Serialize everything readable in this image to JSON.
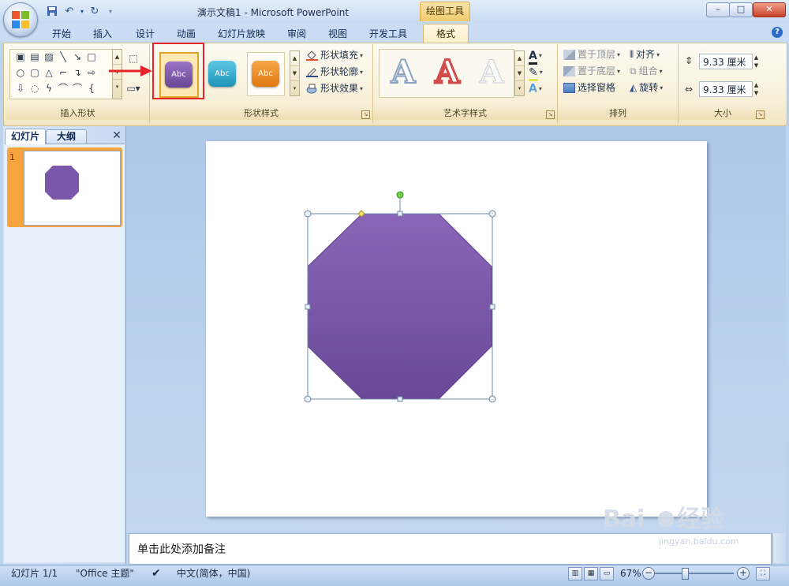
{
  "title_bar": {
    "title": "演示文稿1 - Microsoft PowerPoint",
    "contextual_tab": "绘图工具",
    "minimize": "–",
    "maximize": "□",
    "close": "✕"
  },
  "ribbon_tabs": [
    "开始",
    "插入",
    "设计",
    "动画",
    "幻灯片放映",
    "审阅",
    "视图",
    "开发工具"
  ],
  "active_tab": "格式",
  "groups": {
    "insert_shapes": "插入形状",
    "shape_styles": "形状样式",
    "wordart_styles": "艺术字样式",
    "arrange": "排列",
    "size": "大小"
  },
  "shape_styles": {
    "swatches": [
      {
        "label": "Abc",
        "color": "#7a54a8"
      },
      {
        "label": "Abc",
        "color": "#2aa6c6"
      },
      {
        "label": "Abc",
        "color": "#ef8a1e"
      }
    ],
    "fill": "形状填充",
    "outline": "形状轮廓",
    "effects": "形状效果"
  },
  "wordart": {
    "sample": "A",
    "colors": [
      "#ffffff",
      "#d24a4a",
      "#ffffff"
    ]
  },
  "arrange": {
    "bring_front": "置于顶层",
    "send_back": "置于底层",
    "selection_pane": "选择窗格",
    "align": "对齐",
    "group": "组合",
    "rotate": "旋转"
  },
  "size": {
    "height": "9.33 厘米",
    "width": "9.33 厘米"
  },
  "left_panel": {
    "tab_slides": "幻灯片",
    "tab_outline": "大纲",
    "close": "✕",
    "slide_number": "1"
  },
  "notes_placeholder": "单击此处添加备注",
  "status_bar": {
    "slide_info": "幻灯片 1/1",
    "theme": "\"Office 主题\"",
    "language": "中文(简体，中国)",
    "zoom": "67%"
  },
  "shape": {
    "color": "#7c5aab",
    "color_dark": "#6a4896"
  },
  "watermark": {
    "url": "jingyan.baidu.com"
  }
}
